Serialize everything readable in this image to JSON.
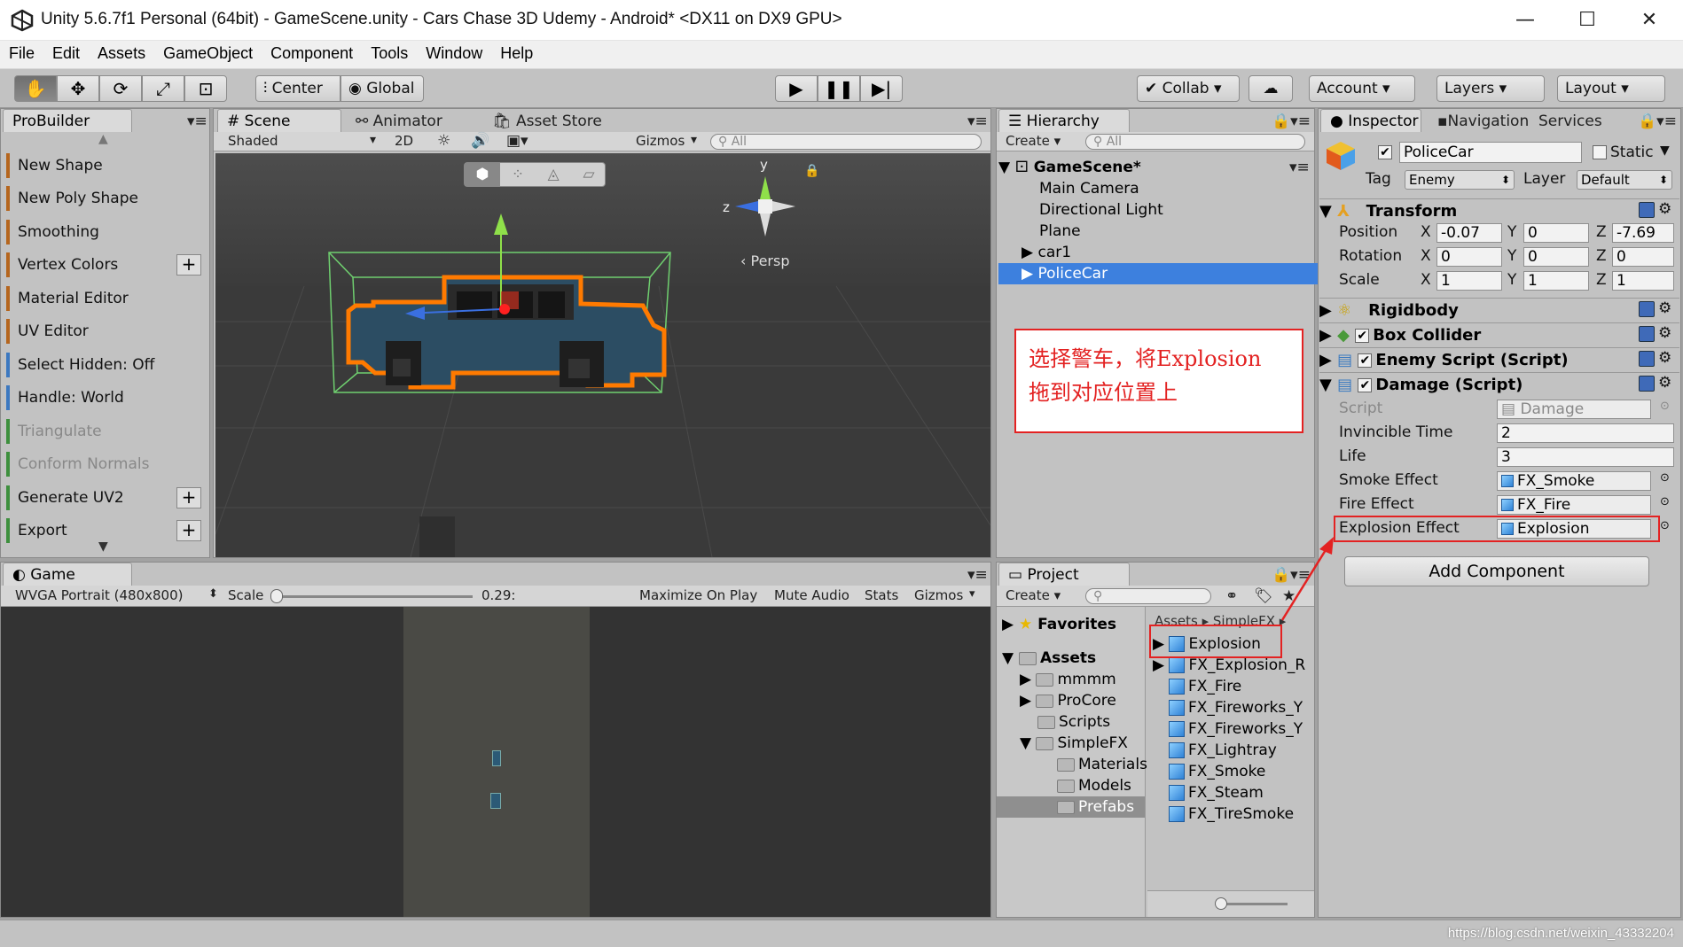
{
  "window": {
    "title": "Unity 5.6.7f1 Personal (64bit) - GameScene.unity - Cars Chase 3D Udemy - Android* <DX11 on DX9 GPU>",
    "minimize": "—",
    "maximize": "☐",
    "close": "✕"
  },
  "menu": [
    "File",
    "Edit",
    "Assets",
    "GameObject",
    "Component",
    "Tools",
    "Window",
    "Help"
  ],
  "toolbar": {
    "center": "Center",
    "global": "Global",
    "collab": "Collab",
    "account": "Account",
    "layers": "Layers",
    "layout": "Layout"
  },
  "probuilder": {
    "tab": "ProBuilder",
    "items": [
      {
        "label": "New Shape",
        "plus": ""
      },
      {
        "label": "New Poly Shape",
        "plus": ""
      },
      {
        "label": "Smoothing",
        "plus": ""
      },
      {
        "label": "Vertex Colors",
        "plus": "+"
      },
      {
        "label": "Material Editor",
        "plus": ""
      },
      {
        "label": "UV Editor",
        "plus": ""
      },
      {
        "label": "Select Hidden: Off",
        "plus": ""
      },
      {
        "label": "Handle: World",
        "plus": ""
      },
      {
        "label": "Triangulate",
        "plus": ""
      },
      {
        "label": "Conform Normals",
        "plus": ""
      },
      {
        "label": "Generate UV2",
        "plus": "+"
      },
      {
        "label": "Export",
        "plus": "+"
      }
    ]
  },
  "scene": {
    "tabs": [
      "Scene",
      "Animator",
      "Asset Store"
    ],
    "shading": "Shaded",
    "mode2d": "2D",
    "gizmos": "Gizmos",
    "search_placeholder": "All",
    "persp": "Persp",
    "axis_y": "y",
    "axis_z": "z"
  },
  "hierarchy": {
    "tab": "Hierarchy",
    "create": "Create",
    "search_placeholder": "All",
    "scene": "GameScene*",
    "items": [
      "Main Camera",
      "Directional Light",
      "Plane",
      "car1",
      "PoliceCar"
    ]
  },
  "annotation": {
    "line1": "选择警车，将Explosion",
    "line2": "拖到对应位置上"
  },
  "inspector": {
    "tabs": [
      "Inspector",
      "Navigation",
      "Services"
    ],
    "object_name": "PoliceCar",
    "static": "Static",
    "tag_label": "Tag",
    "tag": "Enemy",
    "layer_label": "Layer",
    "layer": "Default",
    "transform": {
      "title": "Transform",
      "rows": [
        {
          "label": "Position",
          "x": "-0.07",
          "y": "0",
          "z": "-7.69"
        },
        {
          "label": "Rotation",
          "x": "0",
          "y": "0",
          "z": "0"
        },
        {
          "label": "Scale",
          "x": "1",
          "y": "1",
          "z": "1"
        }
      ]
    },
    "components": [
      "Rigidbody",
      "Box Collider",
      "Enemy Script (Script)",
      "Damage (Script)"
    ],
    "damage": {
      "script_label": "Script",
      "script": "Damage",
      "invincible_label": "Invincible Time",
      "invincible": "2",
      "life_label": "Life",
      "life": "3",
      "smoke_label": "Smoke Effect",
      "smoke": "FX_Smoke",
      "fire_label": "Fire Effect",
      "fire": "FX_Fire",
      "explosion_label": "Explosion Effect",
      "explosion": "Explosion"
    },
    "add_component": "Add Component"
  },
  "game": {
    "tab": "Game",
    "resolution": "WVGA Portrait (480x800)",
    "scale_label": "Scale",
    "scale_value": "0.29:",
    "maximize": "Maximize On Play",
    "mute": "Mute Audio",
    "stats": "Stats",
    "gizmos": "Gizmos"
  },
  "project": {
    "tab": "Project",
    "create": "Create",
    "favorites": "Favorites",
    "assets": "Assets",
    "tree": [
      "mmmm",
      "ProCore",
      "Scripts",
      "SimpleFX",
      "Materials",
      "Models",
      "Prefabs"
    ],
    "breadcrumb": [
      "Assets",
      "SimpleFX"
    ],
    "files": [
      "Explosion",
      "FX_Explosion_R",
      "FX_Fire",
      "FX_Fireworks_Y",
      "FX_Fireworks_Y",
      "FX_Lightray",
      "FX_Smoke",
      "FX_Steam",
      "FX_TireSmoke"
    ]
  },
  "watermark": "https://blog.csdn.net/weixin_43332204",
  "colors": {
    "selection": "#3d80de",
    "annotation": "#e32222",
    "accent_orange": "#ff7a00"
  }
}
